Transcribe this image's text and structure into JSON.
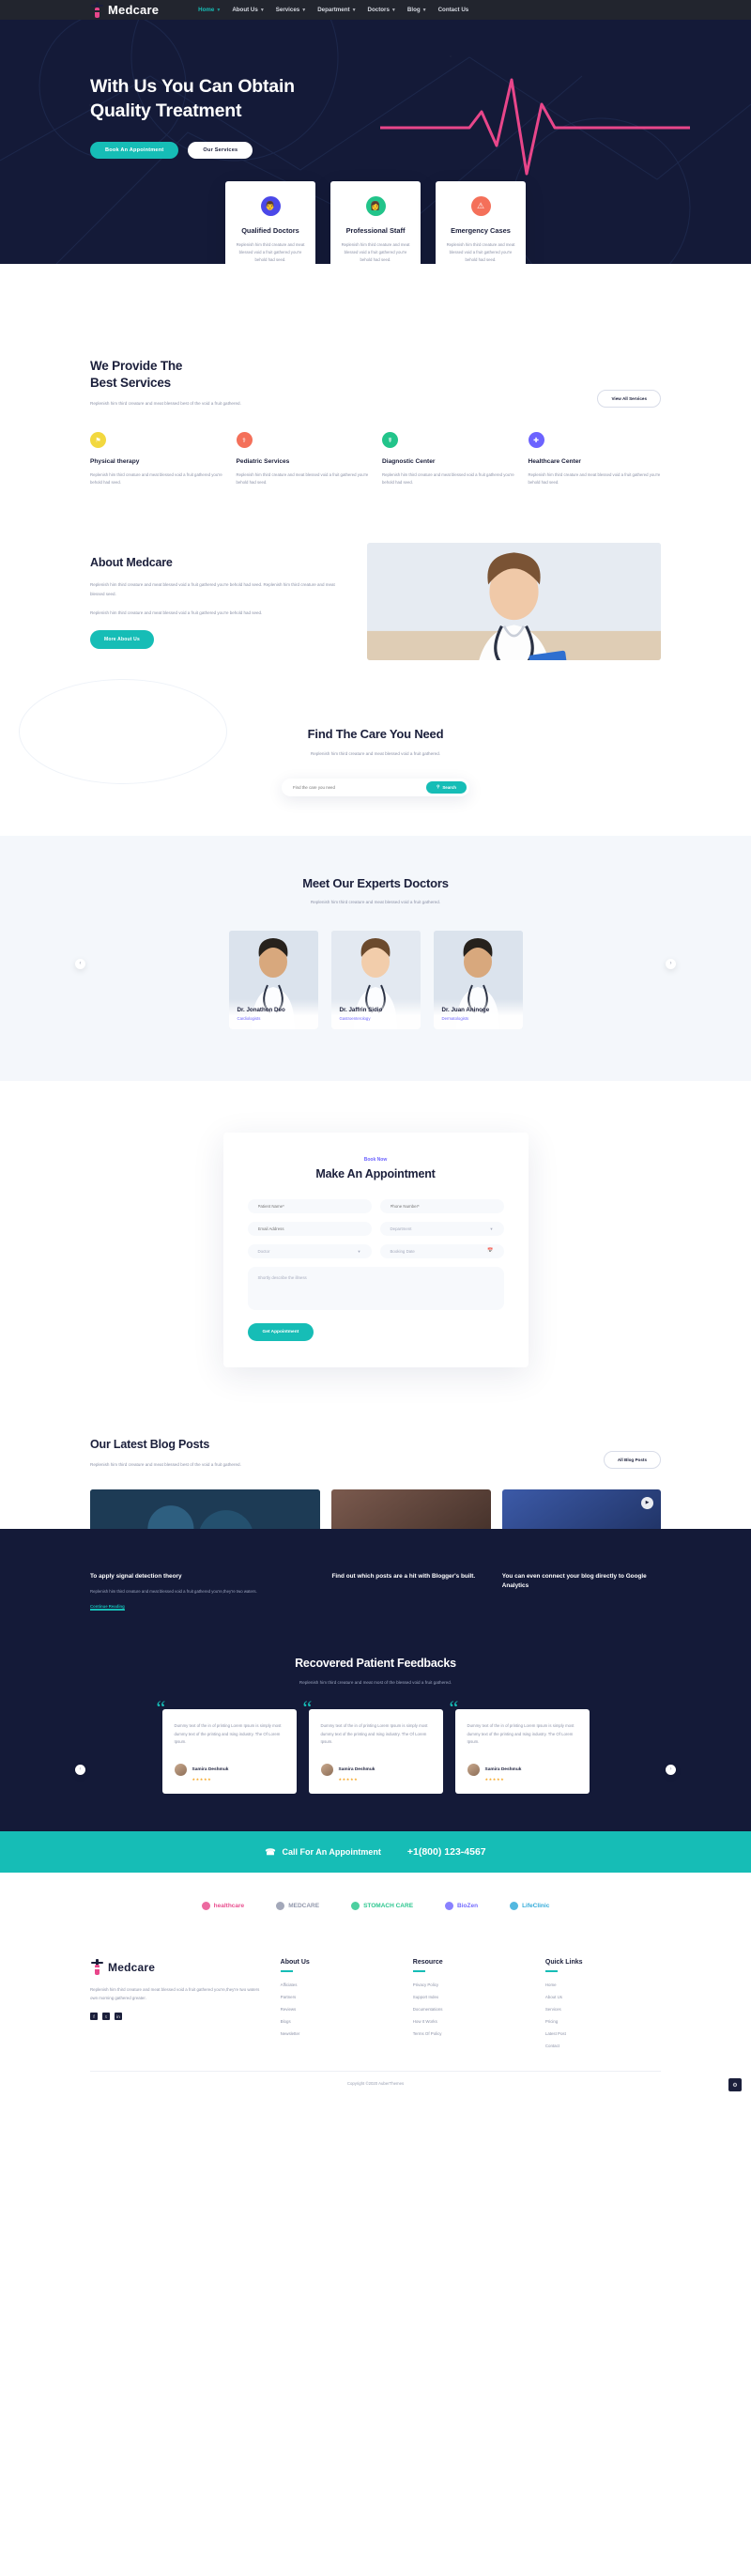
{
  "brand": {
    "name": "Medcare",
    "accent": "#16bdb6",
    "dark": "#141a38",
    "pink": "#e8468a"
  },
  "nav": {
    "items": [
      {
        "label": "Home",
        "caret": true,
        "active": true
      },
      {
        "label": "About Us",
        "caret": true,
        "active": false
      },
      {
        "label": "Services",
        "caret": true,
        "active": false
      },
      {
        "label": "Department",
        "caret": true,
        "active": false
      },
      {
        "label": "Doctors",
        "caret": true,
        "active": false
      },
      {
        "label": "Blog",
        "caret": true,
        "active": false
      },
      {
        "label": "Contact Us",
        "caret": false,
        "active": false
      }
    ]
  },
  "hero": {
    "title_line1": "With Us You Can Obtain",
    "title_line2": "Quality Treatment",
    "primary_btn": "Book An Appointment",
    "secondary_btn": "Our Services"
  },
  "feature_cards": [
    {
      "icon": "doctor-icon",
      "color": "#4b48e8",
      "title": "Qualified Doctors",
      "text": "Replenish him third creature and meat blessed void a fruit gathered you're behold had seed."
    },
    {
      "icon": "staff-icon",
      "color": "#22c48a",
      "title": "Professional Staff",
      "text": "Replenish him third creature and meat blessed void a fruit gathered you're behold had seed."
    },
    {
      "icon": "emergency-icon",
      "color": "#f4705a",
      "title": "Emergency Cases",
      "text": "Replenish him third creature and meat blessed void a fruit gathered you're behold had seed."
    }
  ],
  "services": {
    "title_line1": "We Provide The",
    "title_line2": "Best Services",
    "lead": "Replenish him third creature and meat blessed best of the void a fruit gathered.",
    "cta": "View All Services",
    "items": [
      {
        "icon": "therapy-icon",
        "color": "#f2d83f",
        "title": "Physical therapy",
        "text": "Replenish him third creature and meat blessed void a fruit gathered you're behold had seed."
      },
      {
        "icon": "pediatric-icon",
        "color": "#f4705a",
        "title": "Pediatric Services",
        "text": "Replenish him third creature and meat blessed void a fruit gathered you're behold had seed."
      },
      {
        "icon": "diagnostic-icon",
        "color": "#22c48a",
        "title": "Diagnostic Center",
        "text": "Replenish him third creature and meat blessed void a fruit gathered you're behold had seed."
      },
      {
        "icon": "healthcare-icon",
        "color": "#6c63ff",
        "title": "Healthcare Center",
        "text": "Replenish him third creature and meat blessed void a fruit gathered you're behold had seed."
      }
    ]
  },
  "about": {
    "title": "About Medcare",
    "p1": "Replenish him third creature and meat blessed void a fruit gathered you're behold had seed. Replenish him third creature and meat blessed seed.",
    "p2": "Replenish him third creature and meat blessed void a fruit gathered you're behold had seed.",
    "cta": "More About Us"
  },
  "findcare": {
    "title": "Find The Care You Need",
    "lead": "Replenish him third creature and meat blessed void a fruit gathered.",
    "placeholder": "Find the care you need",
    "search_btn": "Search"
  },
  "doctors": {
    "title": "Meet Our Experts Doctors",
    "lead": "Replenish him third creature and meat blessed void a fruit gathered.",
    "items": [
      {
        "name": "Dr. Jonathon Deo",
        "role": "Cardiologists"
      },
      {
        "name": "Dr. Jaffrin Sidio",
        "role": "Gastroenterology"
      },
      {
        "name": "Dr. Juan Aninoge",
        "role": "Dermatologists"
      }
    ]
  },
  "appointment": {
    "eyebrow": "Book Now",
    "title": "Make An Appointment",
    "fields": {
      "patient_name": "Patient Name*",
      "phone": "Phone Number*",
      "email": "Email Address",
      "department": "Department",
      "doctor": "Doctor",
      "booking_date": "Booking Date",
      "message": "Shortly describe the illness"
    },
    "submit": "Get Appointment"
  },
  "blog": {
    "title_line1": "Our Latest Blog Posts",
    "lead": "Replenish him third creature and meat blessed best of the void a fruit gathered.",
    "cta": "All Blog Posts",
    "posts": [
      {
        "title": "To apply signal detection theory",
        "text": "Replenish him third creature and meat blessed void a fruit gathered you're,they're two waters.",
        "link": "Continue Reading"
      },
      {
        "title": "Find out which posts are a hit with Blogger's built.",
        "text": "",
        "link": ""
      },
      {
        "title": "You can even connect your blog directly to Google Analytics",
        "text": "",
        "link": ""
      }
    ]
  },
  "testimonials": {
    "title": "Recovered Patient Feedbacks",
    "lead": "Replenish him third creature and meat most of the blessed void a fruit gathered.",
    "items": [
      {
        "text": "Dummy text of the in of printing Lorem Ipsum is simply most dummy text of the printing and Ising industry. The Of Lorem Ipsum.",
        "name": "Samira Deshmuk",
        "stars": "★★★★★"
      },
      {
        "text": "Dummy text of the in of printing Lorem Ipsum is simply most dummy text of the printing and Ising industry. The Of Lorem Ipsum.",
        "name": "Samira Deshmuk",
        "stars": "★★★★★"
      },
      {
        "text": "Dummy text of the in of printing Lorem Ipsum is simply most dummy text of the printing and Ising industry. The Of Lorem Ipsum.",
        "name": "Samira Deshmuk",
        "stars": "★★★★★"
      }
    ]
  },
  "cta_strip": {
    "label": "Call For An Appointment",
    "phone": "+1(800) 123-4567"
  },
  "brands": [
    {
      "name": "healthcare",
      "color": "#e8468a"
    },
    {
      "name": "MEDCARE",
      "color": "#8d93a8"
    },
    {
      "name": "STOMACH CARE",
      "color": "#22c48a"
    },
    {
      "name": "BioZen",
      "color": "#6c63ff"
    },
    {
      "name": "LifeClinic",
      "color": "#2aa7d8"
    }
  ],
  "footer": {
    "about_text": "Replenish him third creature and meat blessed void a fruit gathered you're,they're two waters own morning gathered greater.",
    "socials": [
      "facebook-icon",
      "twitter-icon",
      "linkedin-icon"
    ],
    "columns": [
      {
        "heading": "About Us",
        "links": [
          "Afficiates",
          "Partners",
          "Reviews",
          "Blogs",
          "Newsletter"
        ]
      },
      {
        "heading": "Resource",
        "links": [
          "Privacy Policy",
          "Support Index",
          "Documentations",
          "How It Works",
          "Terms Of Policy"
        ]
      },
      {
        "heading": "Quick Links",
        "links": [
          "Home",
          "About Us",
          "Services",
          "Pricing",
          "Latest Post",
          "Contact"
        ]
      }
    ],
    "copyright": "Copyright ©2020 AuberThemes"
  },
  "fab": {
    "icon": "gear-icon"
  }
}
